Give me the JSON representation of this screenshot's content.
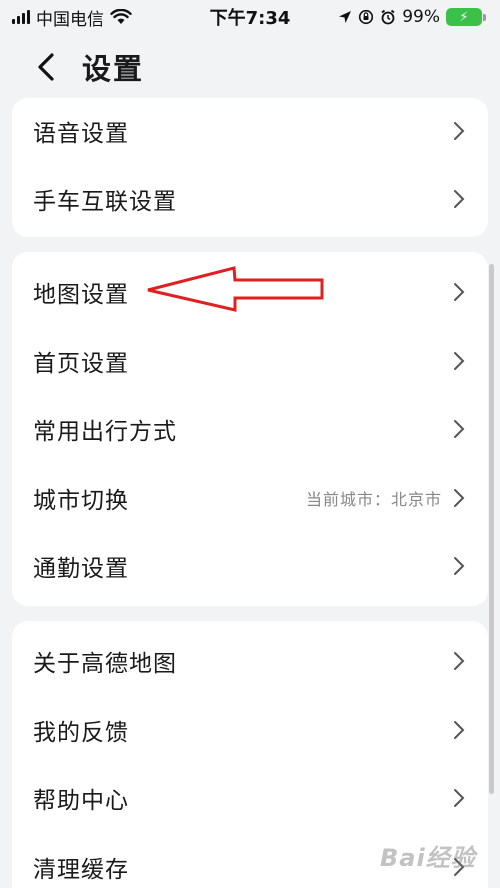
{
  "status_bar": {
    "carrier": "中国电信",
    "time": "下午7:34",
    "battery_percent": "99%",
    "battery_level": 0.99
  },
  "header": {
    "back_icon": "chevron-left-icon",
    "title": "设置"
  },
  "groups": [
    {
      "items": [
        {
          "label": "语音设置"
        },
        {
          "label": "手车互联设置"
        }
      ]
    },
    {
      "items": [
        {
          "label": "地图设置"
        },
        {
          "label": "首页设置"
        },
        {
          "label": "常用出行方式"
        },
        {
          "label": "城市切换",
          "value": "当前城市：北京市"
        },
        {
          "label": "通勤设置"
        }
      ]
    },
    {
      "items": [
        {
          "label": "关于高德地图"
        },
        {
          "label": "我的反馈"
        },
        {
          "label": "帮助中心"
        },
        {
          "label": "清理缓存"
        }
      ]
    }
  ],
  "annotation": {
    "icon": "red-arrow-icon",
    "color": "#e02020"
  },
  "watermark": {
    "text": "Bai经验"
  }
}
